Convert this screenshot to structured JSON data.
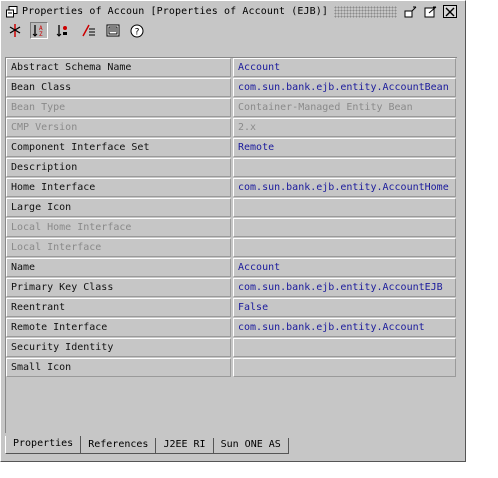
{
  "window": {
    "title": "Properties of Accoun [Properties of Account (EJB)]"
  },
  "toolbar": {
    "buttons": [
      {
        "name": "pin-icon"
      },
      {
        "name": "sort-alphabetic-icon"
      },
      {
        "name": "sort-type-icon"
      },
      {
        "name": "filter-icon"
      },
      {
        "name": "customize-icon"
      },
      {
        "name": "help-icon"
      }
    ]
  },
  "properties": [
    {
      "name": "Abstract Schema Name",
      "value": "Account",
      "enabled": true
    },
    {
      "name": "Bean Class",
      "value": "com.sun.bank.ejb.entity.AccountBean",
      "enabled": true
    },
    {
      "name": "Bean Type",
      "value": "Container-Managed Entity Bean",
      "enabled": false
    },
    {
      "name": "CMP Version",
      "value": "2.x",
      "enabled": false
    },
    {
      "name": "Component Interface Set",
      "value": "Remote",
      "enabled": true
    },
    {
      "name": "Description",
      "value": "",
      "enabled": true
    },
    {
      "name": "Home Interface",
      "value": "com.sun.bank.ejb.entity.AccountHome",
      "enabled": true
    },
    {
      "name": "Large Icon",
      "value": "",
      "enabled": true
    },
    {
      "name": "Local Home Interface",
      "value": "",
      "enabled": false
    },
    {
      "name": "Local Interface",
      "value": "",
      "enabled": false
    },
    {
      "name": "Name",
      "value": "Account",
      "enabled": true
    },
    {
      "name": "Primary Key Class",
      "value": "com.sun.bank.ejb.entity.AccountEJB",
      "enabled": true
    },
    {
      "name": "Reentrant",
      "value": "False",
      "enabled": true
    },
    {
      "name": "Remote Interface",
      "value": "com.sun.bank.ejb.entity.Account",
      "enabled": true
    },
    {
      "name": "Security Identity",
      "value": "",
      "enabled": true
    },
    {
      "name": "Small Icon",
      "value": "",
      "enabled": true
    }
  ],
  "tabs": [
    {
      "label": "Properties",
      "active": true
    },
    {
      "label": "References",
      "active": false
    },
    {
      "label": "J2EE RI",
      "active": false
    },
    {
      "label": "Sun ONE AS",
      "active": false
    }
  ],
  "colors": {
    "set_value": "#1a1a9c",
    "disabled": "#8a8a8a",
    "panel": "#c6c6c6"
  }
}
